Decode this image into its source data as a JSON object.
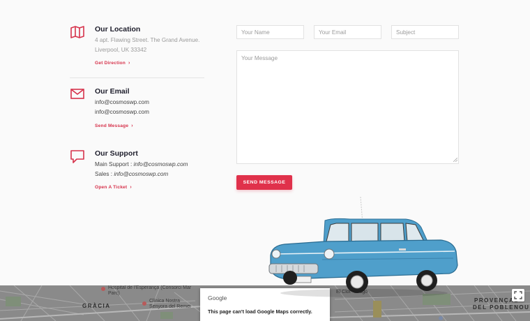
{
  "location": {
    "title": "Our Location",
    "address_line1": "4 apt. Flawing Street. The Grand Avenue.",
    "address_line2": "Liverpool, UK 33342",
    "link": "Get Direction"
  },
  "email": {
    "title": "Our Email",
    "line1": "info@cosmoswp.com",
    "line2": "info@cosmoswp.com",
    "link": "Send Message"
  },
  "support": {
    "title": "Our Support",
    "main_label": "Main Support : ",
    "main_value": "info@cosmoswp.com",
    "sales_label": "Sales : ",
    "sales_value": "info@cosmoswp.com",
    "link": "Open A Ticket"
  },
  "form": {
    "name_placeholder": "Your Name",
    "email_placeholder": "Your Email",
    "subject_placeholder": "Subject",
    "message_placeholder": "Your Message",
    "submit_label": "SEND MESSAGE"
  },
  "map": {
    "labels": [
      "GRÀCIA",
      "PROVENÇAL",
      "DEL POBLENOU"
    ],
    "poi_hospital": "Hospital de l'Esperança (Consorci Mar Parc)",
    "poi_clinic": "Clínica Nostra Senyora del Remei",
    "poi_clot": "El Clot - Aragó",
    "error_brand": "Google",
    "error_message": "This page can't load Google Maps correctly."
  },
  "colors": {
    "accent": "#e0314b",
    "icon": "#d6324b",
    "car_body": "#4f9fcb"
  },
  "icons": [
    "map-icon",
    "mail-icon",
    "chat-icon",
    "chevron-right-icon",
    "fullscreen-icon"
  ]
}
